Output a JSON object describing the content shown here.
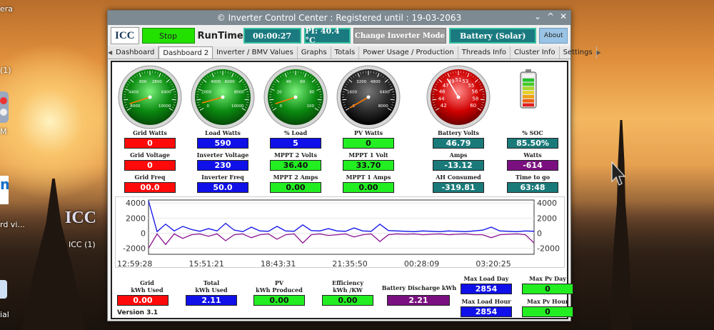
{
  "window": {
    "title": "© Inverter Control Center : Registered until : 19-03-2063",
    "controls": {
      "collapse": "⌄",
      "up": "^",
      "close": "✕"
    }
  },
  "header": {
    "logo": "ICC",
    "stop_label": "Stop",
    "runtime_label": "RunTime",
    "runtime_value": "00:00:27",
    "pi_temp": "PI: 40.4 °C",
    "change_mode": "Change Inverter Mode",
    "battery_mode": "Battery (Solar)",
    "about": "About"
  },
  "tabs": [
    "Dashboard",
    "Dashboard 2",
    "Inverter / BMV Values",
    "Graphs",
    "Totals",
    "Power Usage / Production",
    "Threads Info",
    "Cluster Info",
    "Settings"
  ],
  "active_tab": 1,
  "gauges": [
    {
      "name": "grid-watts-gauge",
      "face": "green",
      "ticks": [
        "800",
        "2800",
        "4400",
        "6400",
        "8000",
        "10000"
      ],
      "needle": 0.05,
      "color": "#ff7a00"
    },
    {
      "name": "load-watts-gauge",
      "face": "green",
      "ticks": [
        "4000",
        "6000",
        "2000",
        "8000",
        "0",
        "10000"
      ],
      "needle": 0.06,
      "color": "#ff7a00"
    },
    {
      "name": "load-percent-gauge",
      "face": "green",
      "ticks": [
        "40",
        "60",
        "20",
        "80",
        "0",
        "100"
      ],
      "needle": 0.05,
      "color": "#ff7a00"
    },
    {
      "name": "pv-watts-gauge",
      "face": "black",
      "ticks": [
        "3200",
        "4800",
        "1600",
        "6400",
        "0",
        "8000"
      ],
      "needle": 0.0,
      "color": "#ff7a00"
    },
    {
      "name": "battery-volts-gauge",
      "face": "red",
      "ticks": [
        "49",
        "51",
        "53",
        "47",
        "55",
        "46",
        "56",
        "44",
        "58",
        "42",
        "60"
      ],
      "needle": 0.37,
      "color": "#ffffff"
    }
  ],
  "labels": {
    "grid_watts": "Grid Watts",
    "load_watts": "Load Watts",
    "pct_load": "% Load",
    "pv_watts": "PV Watts",
    "battery_volts": "Battery Volts",
    "pct_soc": "% SOC",
    "grid_voltage": "Grid Voltage",
    "inverter_voltage": "Inverter Voltage",
    "mppt2_volts": "MPPT 2 Volts",
    "mppt1_volt": "MPPT 1 Volt",
    "amps": "Amps",
    "watts": "Watts",
    "grid_freq": "Grid Freq",
    "inverter_freq": "Inverter Freq",
    "mppt2_amps": "MPPT 2 Amps",
    "mppt1_amps": "MPPT 1 Amps",
    "ah_consumed": "AH Consumed",
    "time_to_go": "Time to go"
  },
  "values": {
    "grid_watts": "0",
    "load_watts": "590",
    "pct_load": "5",
    "pv_watts": "0",
    "battery_volts": "46.79",
    "pct_soc": "85.50%",
    "grid_voltage": "0",
    "inverter_voltage": "230",
    "mppt2_volts": "36.40",
    "mppt1_volt": "33.70",
    "amps": "-13.12",
    "watts": "-614",
    "grid_freq": "00.0",
    "inverter_freq": "50.0",
    "mppt2_amps": "0.00",
    "mppt1_amps": "0.00",
    "ah_consumed": "-319.81",
    "time_to_go": "63:48"
  },
  "battery": {
    "soc_percent": 85.5
  },
  "chart_data": {
    "type": "line",
    "y_left_ticks": [
      "4000",
      "2000",
      "0",
      "-2000"
    ],
    "y_right_ticks": [
      "4000",
      "2000",
      "0",
      "-2000"
    ],
    "x_ticks": [
      "12:59:28",
      "15:51:21",
      "18:43:31",
      "21:35:50",
      "00:28:09",
      "03:20:25"
    ],
    "ylim": [
      -2800,
      4400
    ],
    "series": [
      {
        "color": "#1010e8",
        "values": [
          4300,
          200,
          1200,
          300,
          900,
          500,
          250,
          600,
          300,
          1300,
          400,
          200,
          800,
          300,
          250,
          900,
          300,
          250,
          1100,
          350,
          300,
          600,
          300,
          250,
          700,
          300,
          250,
          1200,
          350,
          300,
          250,
          200,
          300,
          250,
          200,
          300,
          250,
          200,
          300,
          400,
          800,
          300,
          250,
          200,
          300,
          250
        ]
      },
      {
        "color": "#8a1090",
        "values": [
          -2000,
          -100,
          -1500,
          -100,
          -700,
          -200,
          -100,
          -400,
          -100,
          -1000,
          -200,
          -100,
          -600,
          -200,
          -100,
          -800,
          -200,
          -100,
          -1300,
          -200,
          -100,
          -300,
          -200,
          -100,
          -500,
          -200,
          -100,
          -1100,
          -200,
          -100,
          -150,
          -100,
          -200,
          -150,
          -100,
          -200,
          -150,
          -100,
          -200,
          -200,
          -600,
          -200,
          -150,
          -100,
          -200,
          -1300
        ]
      }
    ]
  },
  "totals": {
    "grid_used_label": "Grid\nkWh Used",
    "grid_used": "0.00",
    "total_used_label": "Total\nkWh Used",
    "total_used": "2.11",
    "pv_produced_label": "PV\nkWh Produced",
    "pv_produced": "0.00",
    "efficiency_label": "Efficiency\nkWh /KW",
    "efficiency": "0.00",
    "battery_discharge_label": "Battery Discharge kWh",
    "battery_discharge": "2.21",
    "max_load_day_label": "Max Load Day",
    "max_load_day": "2854",
    "max_pv_day_label": "Max Pv Day",
    "max_pv_day": "0",
    "max_load_hour_label": "Max Load Hour",
    "max_load_hour": "2854",
    "max_pv_hour_label": "Max Pv Hour",
    "max_pv_hour": "0"
  },
  "version": "Version 3.1",
  "desktop": {
    "icc_label": "ICC (1)",
    "partial_labels": [
      "era",
      "(1)",
      "M",
      "rd vi...",
      "ial"
    ]
  }
}
